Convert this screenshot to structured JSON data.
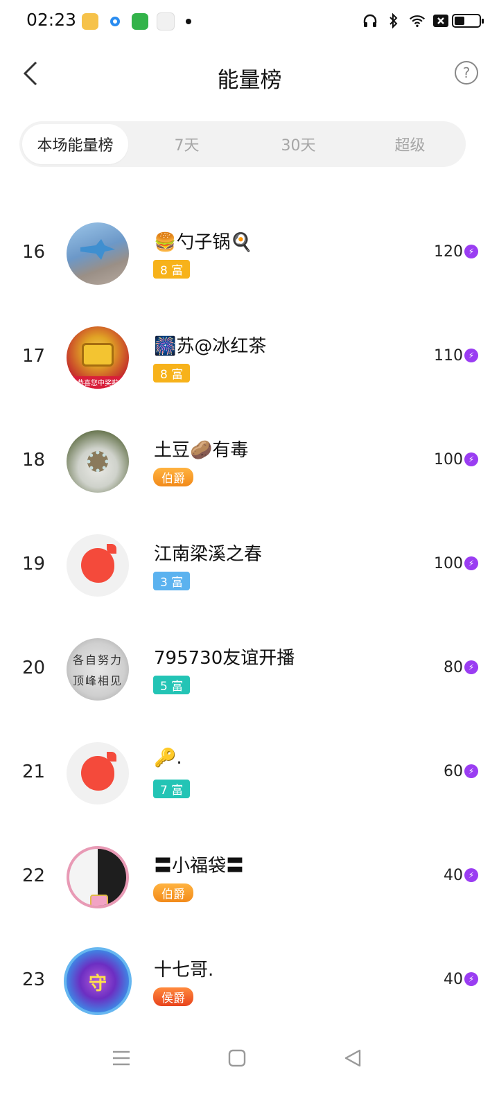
{
  "status_bar": {
    "time": "02:23",
    "notification_icons": [
      "book-icon",
      "browser-icon",
      "store-icon",
      "wallet-icon",
      "dot-icon"
    ],
    "system_icons": [
      "headphones-icon",
      "bluetooth-icon",
      "wifi-icon",
      "sim-off-icon",
      "battery-icon"
    ]
  },
  "header": {
    "title": "能量榜",
    "back_icon": "chevron-left-icon",
    "help_icon": "question-icon"
  },
  "tabs": [
    {
      "label": "本场能量榜",
      "active": true
    },
    {
      "label": "7天",
      "active": false
    },
    {
      "label": "30天",
      "active": false
    },
    {
      "label": "超级",
      "active": false
    }
  ],
  "ranking": [
    {
      "rank": "16",
      "name": "🍔勺子锅🍳",
      "badge": "8 富",
      "score": "120"
    },
    {
      "rank": "17",
      "name": "🎆苏@冰红茶",
      "badge": "8 富",
      "score": "110",
      "avatar_caption": "恭喜您中奖啦"
    },
    {
      "rank": "18",
      "name": "土豆🥔有毒",
      "badge": "伯爵",
      "score": "100"
    },
    {
      "rank": "19",
      "name": "江南梁溪之春",
      "badge": "3 富",
      "score": "100"
    },
    {
      "rank": "20",
      "name": "795730友谊开播",
      "badge": "5 富",
      "score": "80",
      "avatar_text_1": "各自努力",
      "avatar_text_2": "顶峰相见"
    },
    {
      "rank": "21",
      "name": "🔑.",
      "badge": "7 富",
      "score": "60"
    },
    {
      "rank": "22",
      "name": "〓小福袋〓",
      "badge": "伯爵",
      "score": "40"
    },
    {
      "rank": "23",
      "name": "十七哥.",
      "badge": "侯爵",
      "score": "40",
      "avatar_text": "守"
    }
  ],
  "colors": {
    "badge_orange": "#f7b21a",
    "badge_blue": "#5bb2ef",
    "badge_teal": "#23c4b5",
    "energy_purple": "#9a3df2"
  },
  "nav": {
    "menu_icon": "menu-icon",
    "home_icon": "home-square-icon",
    "back_icon": "back-triangle-icon"
  }
}
